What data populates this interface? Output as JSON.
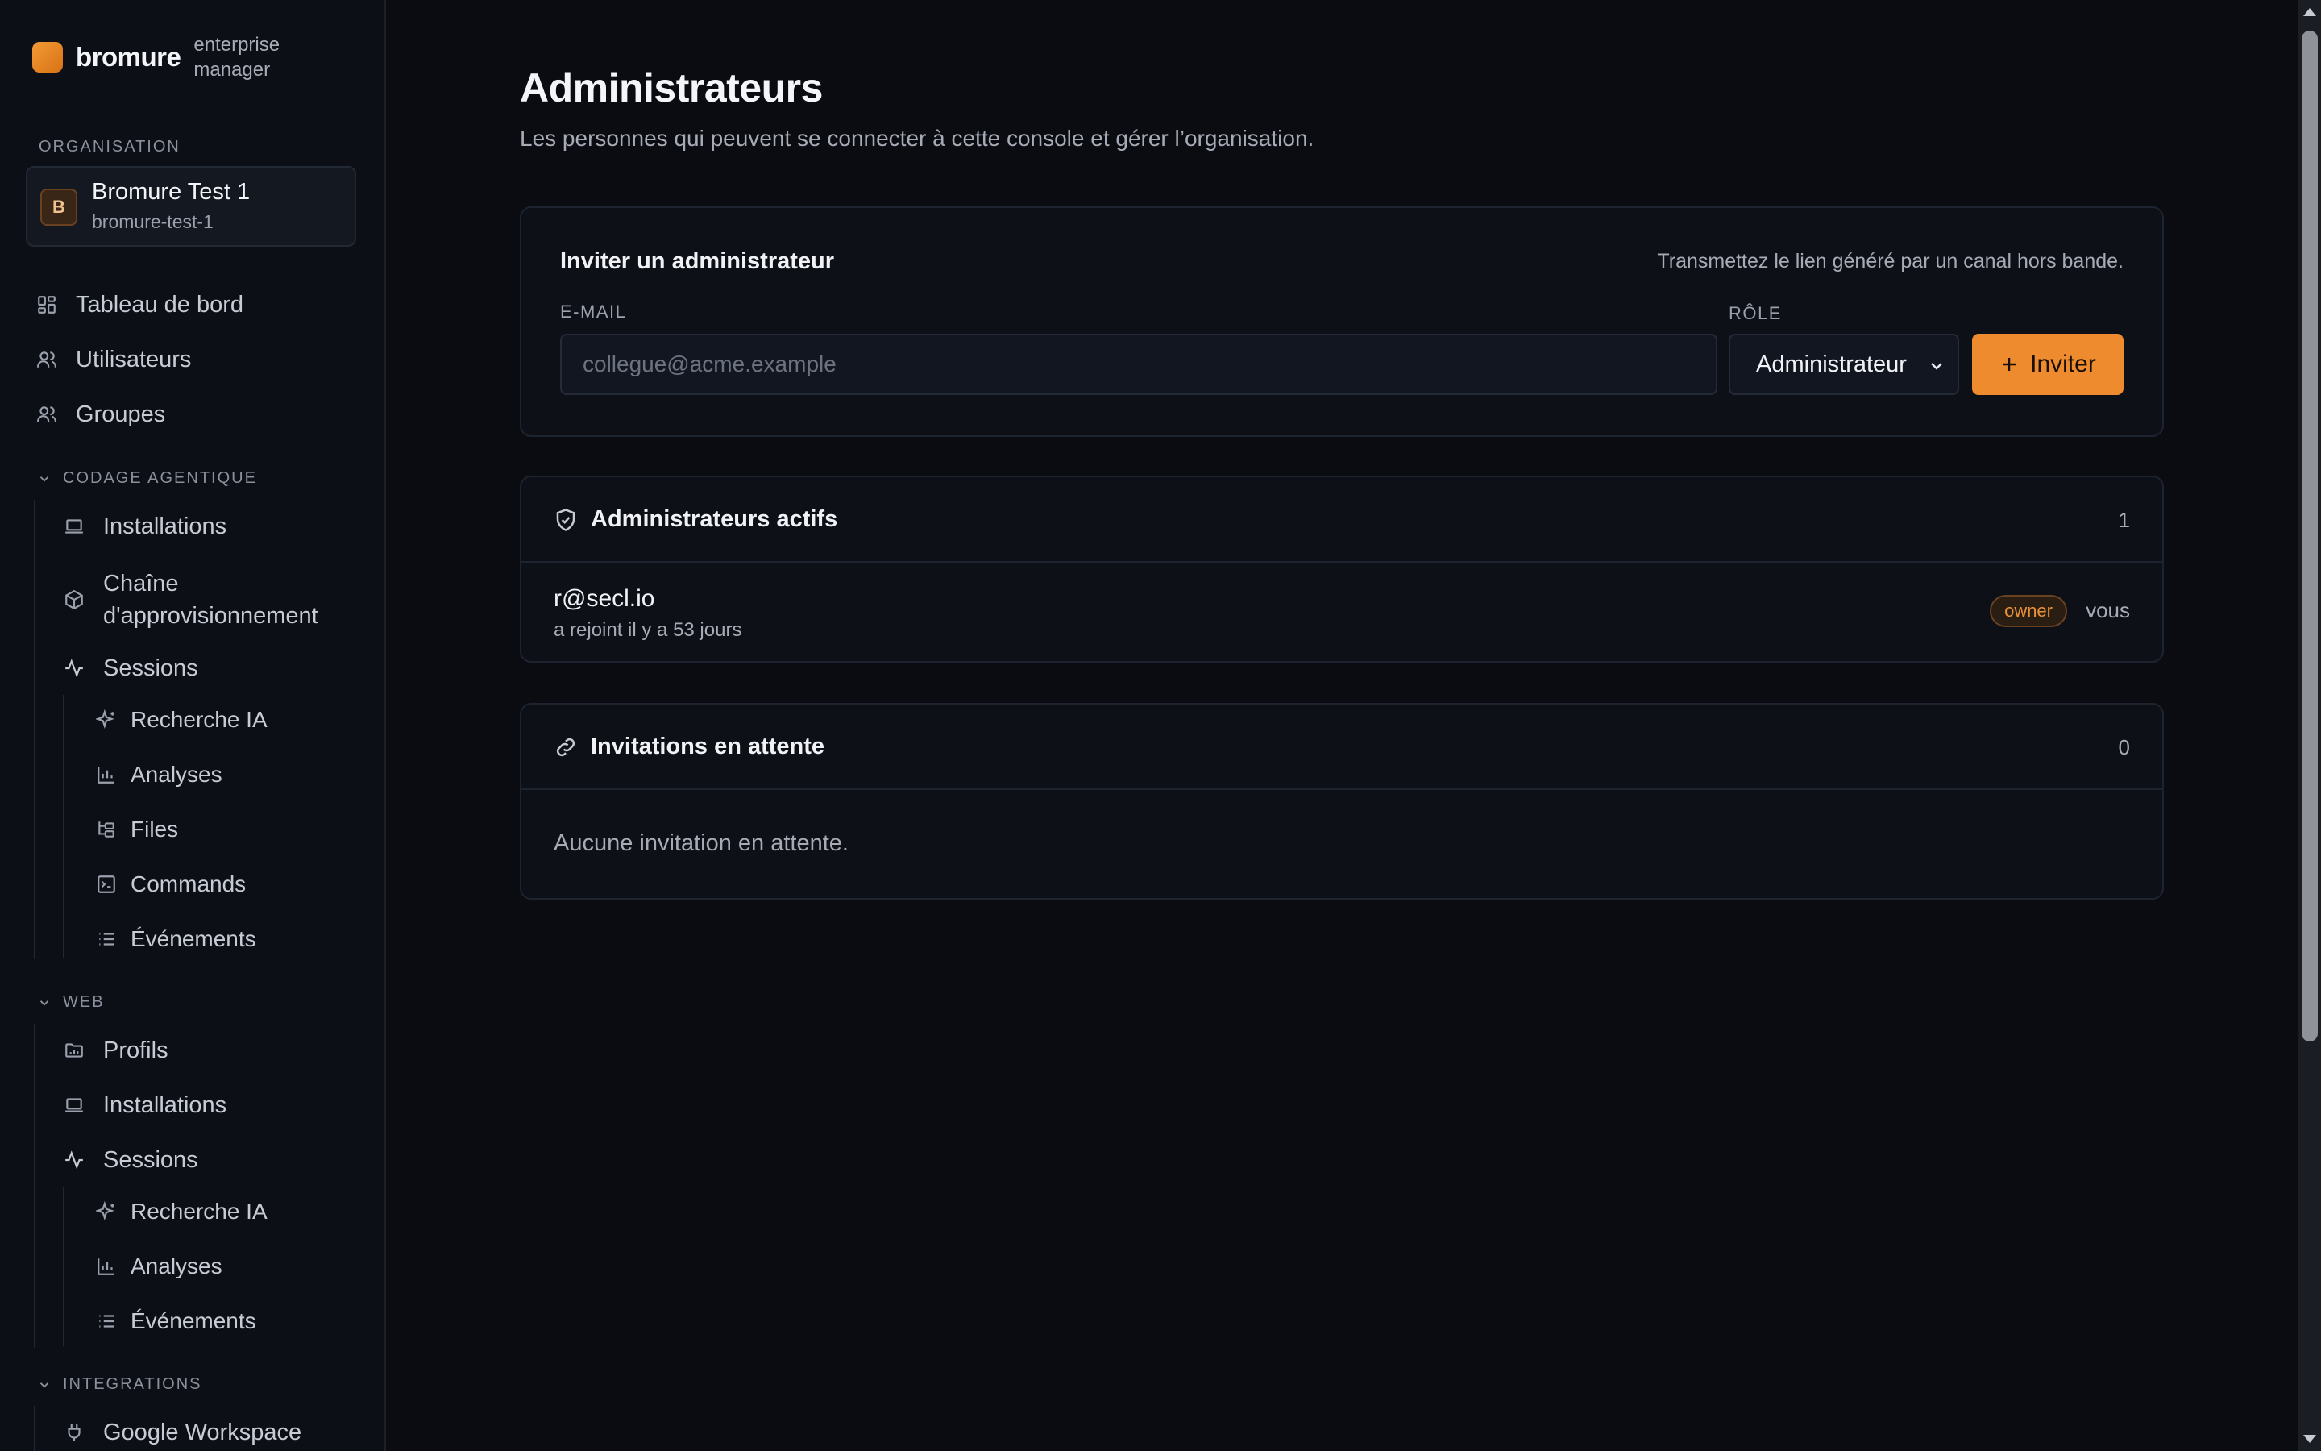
{
  "brand": {
    "name": "bromure",
    "subtitle": "enterprise manager"
  },
  "sidebar": {
    "org_section_label": "ORGANISATION",
    "org": {
      "initial": "B",
      "name": "Bromure Test 1",
      "slug": "bromure-test-1"
    },
    "top_items": [
      {
        "label": "Tableau de bord",
        "icon": "dashboard-icon"
      },
      {
        "label": "Utilisateurs",
        "icon": "users-icon"
      },
      {
        "label": "Groupes",
        "icon": "group-icon"
      }
    ],
    "agentic": {
      "label": "CODAGE AGENTIQUE",
      "items": [
        {
          "label": "Installations",
          "icon": "laptop-icon"
        },
        {
          "label": "Chaîne d'approvisionnement",
          "icon": "package-icon"
        },
        {
          "label": "Sessions",
          "icon": "activity-icon"
        }
      ],
      "sub_items": [
        {
          "label": "Recherche IA",
          "icon": "sparkles-icon"
        },
        {
          "label": "Analyses",
          "icon": "bar-chart-icon"
        },
        {
          "label": "Files",
          "icon": "files-icon"
        },
        {
          "label": "Commands",
          "icon": "terminal-icon"
        },
        {
          "label": "Événements",
          "icon": "list-icon"
        }
      ]
    },
    "web": {
      "label": "WEB",
      "items": [
        {
          "label": "Profils",
          "icon": "folder-icon"
        },
        {
          "label": "Installations",
          "icon": "laptop-icon"
        },
        {
          "label": "Sessions",
          "icon": "activity-icon"
        }
      ],
      "sub_items": [
        {
          "label": "Recherche IA",
          "icon": "sparkles-icon"
        },
        {
          "label": "Analyses",
          "icon": "bar-chart-icon"
        },
        {
          "label": "Événements",
          "icon": "list-icon"
        }
      ]
    },
    "integrations": {
      "label": "INTEGRATIONS",
      "items": [
        {
          "label": "Google Workspace",
          "icon": "plug-icon"
        }
      ]
    }
  },
  "main": {
    "title": "Administrateurs",
    "subtitle": "Les personnes qui peuvent se connecter à cette console et gérer l’organisation.",
    "invite": {
      "title": "Inviter un administrateur",
      "hint": "Transmettez le lien généré par un canal hors bande.",
      "email_label": "E-MAIL",
      "email_placeholder": "collegue@acme.example",
      "email_value": "",
      "role_label": "RÔLE",
      "role_value": "Administrateur",
      "button_label": "Inviter"
    },
    "active": {
      "title": "Administrateurs actifs",
      "count": "1",
      "admins": [
        {
          "email": "r@secl.io",
          "joined": "a rejoint il y a 53 jours",
          "badge": "owner",
          "you": "vous"
        }
      ]
    },
    "pending": {
      "title": "Invitations en attente",
      "count": "0",
      "empty_text": "Aucune invitation en attente."
    }
  },
  "colors": {
    "accent": "#ee8b2e",
    "background": "#0a0c12",
    "sidebar": "#0c0f16",
    "card": "#0d1017",
    "border": "#1e2330"
  }
}
